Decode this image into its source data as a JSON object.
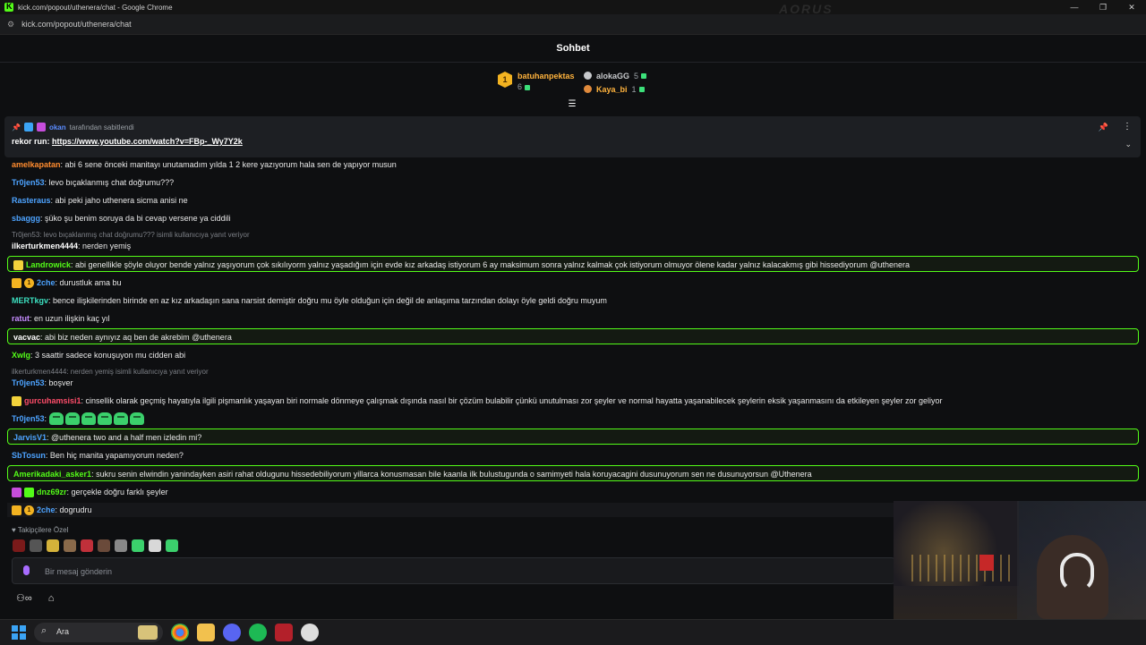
{
  "browser": {
    "window_title": "kick.com/popout/uthenera/chat - Google Chrome",
    "url": "kick.com/popout/uthenera/chat"
  },
  "chat": {
    "title": "Sohbet"
  },
  "leaderboard": {
    "first": {
      "rank": "1",
      "name": "batuhanpektas",
      "count": "6"
    },
    "others": [
      {
        "name": "alokaGG",
        "count": "5",
        "color": "#c7c9cc"
      },
      {
        "name": "Kaya_bi",
        "count": "1",
        "color": "#ffb33d"
      }
    ]
  },
  "pinned": {
    "pinned_by": "okan",
    "pinned_by_suffix": "tarafından sabitlendi",
    "message_prefix": "rekor run:",
    "link": "https://www.youtube.com/watch?v=FBp-_Wy7Y2k"
  },
  "messages": [
    {
      "user": "amelkapatan",
      "color": "#ff8c2f",
      "text": ": abi 6 sene önceki manitayı unutamadım yılda 1 2 kere yazıyorum hala sen de yapıyor musun"
    },
    {
      "user": "Tr0jen53",
      "color": "#4da3ff",
      "text": ": levo bıçaklanmış chat doğrumu???"
    },
    {
      "user": "Rasteraus",
      "color": "#4da3ff",
      "text": ": abi peki jaho uthenera sicma anisi ne"
    },
    {
      "user": "sbaggg",
      "color": "#4da3ff",
      "text": ": şüko şu benim soruya da bi cevap versene ya ciddili"
    },
    {
      "reply": "Tr0jen53: levo bıçaklanmış chat doğrumu??? isimli kullanıcıya yanıt veriyor"
    },
    {
      "user": "ilkerturkmen4444",
      "color": "#ffffff",
      "text": ": nerden yemiş"
    },
    {
      "user": "Landrowick",
      "color": "#53fc18",
      "text": ": abi genellikle şöyle oluyor bende yalnız yaşıyorum çok sıkılıyorm yalnız yaşadığım için evde kız arkadaş istiyorum 6 ay maksimum sonra yalnız kalmak çok istiyorum olmuyor ölene kadar yalnız kalacakmış gibi hissediyorum @uthenera"
    },
    {
      "user": "2che",
      "color": "#4da3ff",
      "text": ": durustluk ama bu"
    },
    {
      "user": "MERTkgv",
      "color": "#3ce0c0",
      "text": ": bence ilişkilerinden birinde en az kız arkadaşın sana narsist demiştir doğru mu öyle olduğun için değil de anlaşıma tarzından dolayı öyle geldi doğru muyum"
    },
    {
      "user": "ratut",
      "color": "#c58cff",
      "text": ": en uzun ilişkin kaç yıl"
    },
    {
      "user": "vacvac",
      "color": "#ffffff",
      "text": ": abi biz neden aynıyız aq ben de akrebim @uthenera"
    },
    {
      "user": "Xwlg",
      "color": "#53fc18",
      "text": ": 3 saattir sadece konuşuyon mu cidden abi"
    },
    {
      "reply": "ilkerturkmen4444: nerden yemiş isimli kullanıcıya yanıt veriyor"
    },
    {
      "user": "Tr0jen53",
      "color": "#4da3ff",
      "text": ": boşver"
    },
    {
      "user": "gurcuhamsisi1",
      "color": "#ff4d6a",
      "text": ": cinsellik olarak geçmiş hayatıyla ilgili pişmanlık yaşayan biri normale dönmeye çalışmak dışında nasıl bir çözüm bulabilir çünkü unutulması zor şeyler ve normal hayatta yaşanabilecek şeylerin eksik yaşanmasını da etkileyen şeyler zor geliyor"
    },
    {
      "user": "Tr0jen53",
      "color": "#4da3ff",
      "text": ":"
    },
    {
      "user": "JarvisV1",
      "color": "#4da3ff",
      "text": ": @uthenera two and a half men izledin mi?"
    },
    {
      "user": "SbTosun",
      "color": "#4da3ff",
      "text": ": Ben hiç manita yapamıyorum neden?"
    },
    {
      "user": "Amerikadaki_asker1",
      "color": "#53fc18",
      "text": ": sukru senin elwindin yanindayken asiri rahat oldugunu hissedebiliyorum yillarca konusmasan bile kaanla ilk bulustugunda o samimyeti hala koruyacagini dusunuyorum sen ne dusunuyorsun @Uthenera"
    },
    {
      "user": "dnz69zr",
      "color": "#53fc18",
      "text": ": gerçekle doğru farklı şeyler"
    },
    {
      "user": "2che",
      "color": "#4da3ff",
      "text": ": dogrudru"
    }
  ],
  "badges": {
    "coin_label": "1"
  },
  "followers_only": "Takipçilere Özel",
  "input": {
    "placeholder": "Bir mesaj gönderin"
  },
  "taskbar": {
    "search_placeholder": "Ara"
  }
}
